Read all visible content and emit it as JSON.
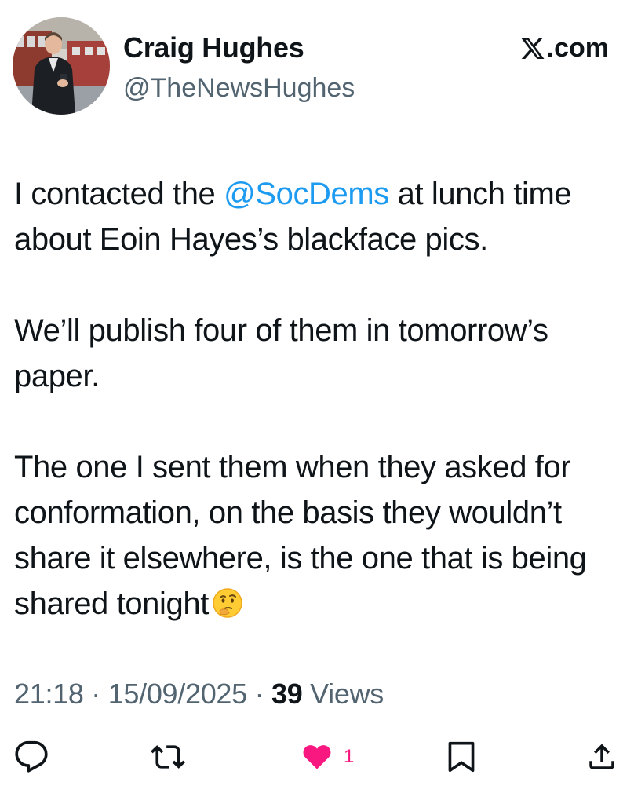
{
  "author": {
    "name": "Craig Hughes",
    "handle": "@TheNewsHughes",
    "avatar_icon": "profile-photo"
  },
  "source": {
    "label": ".com",
    "logo_icon": "x-logo-icon"
  },
  "tweet": {
    "p1_a": "I contacted the ",
    "p1_mention": "@SocDems",
    "p1_b": " at lunch time about Eoin Hayes’s blackface pics.",
    "p2": "We’ll publish four of them in tomorrow’s paper.",
    "p3": "The one I sent them when they asked for conformation, on the basis they wouldn’t share it elsewhere, is the one that is being shared tonight",
    "emoji": "thinking-face-emoji",
    "mention_color": "#1d9bf0"
  },
  "meta": {
    "time": "21:18",
    "sep1": " · ",
    "date": "15/09/2025",
    "sep2": " · ",
    "views_count": "39",
    "views_label": " Views"
  },
  "actions": {
    "reply_icon": "reply-icon",
    "retweet_icon": "retweet-icon",
    "like_icon": "heart-icon",
    "like_count": "1",
    "like_color": "#f91880",
    "bookmark_icon": "bookmark-icon",
    "share_icon": "share-icon"
  }
}
